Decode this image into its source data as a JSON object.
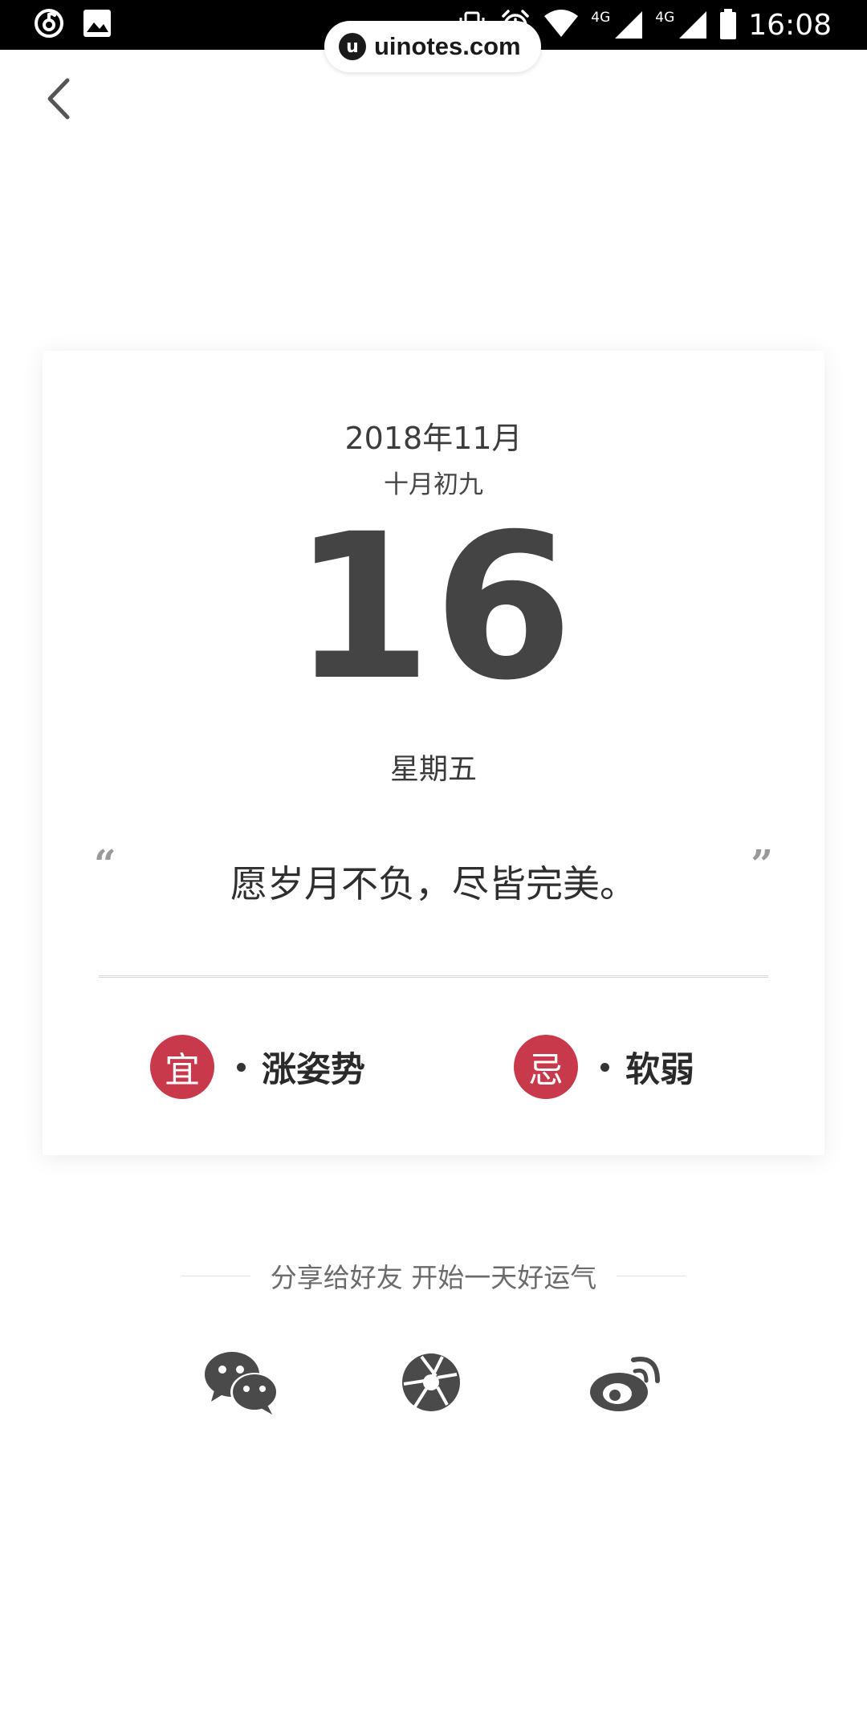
{
  "status_bar": {
    "time": "16:08",
    "network_1": "4G",
    "network_2": "4G",
    "icons": [
      "netease-music-icon",
      "gallery-icon",
      "vibrate-icon",
      "alarm-icon",
      "wifi-icon",
      "signal-icon",
      "signal-icon",
      "battery-icon"
    ]
  },
  "watermark": {
    "logo_letter": "u",
    "text": "uinotes.com"
  },
  "header": {
    "back_icon": "chevron-left-icon"
  },
  "card": {
    "year_month": "2018年11月",
    "lunar_date": "十月初九",
    "day": "16",
    "weekday": "星期五",
    "quote_open": "“",
    "quote": "愿岁月不负，尽皆完美。",
    "quote_close": "”",
    "good": {
      "seal": "宜",
      "text": "涨姿势"
    },
    "bad": {
      "seal": "忌",
      "text": "软弱"
    },
    "seal_color": "#c83a4b"
  },
  "share": {
    "title": "分享给好友 开始一天好运气",
    "targets": [
      "wechat-icon",
      "moments-icon",
      "weibo-icon"
    ]
  }
}
